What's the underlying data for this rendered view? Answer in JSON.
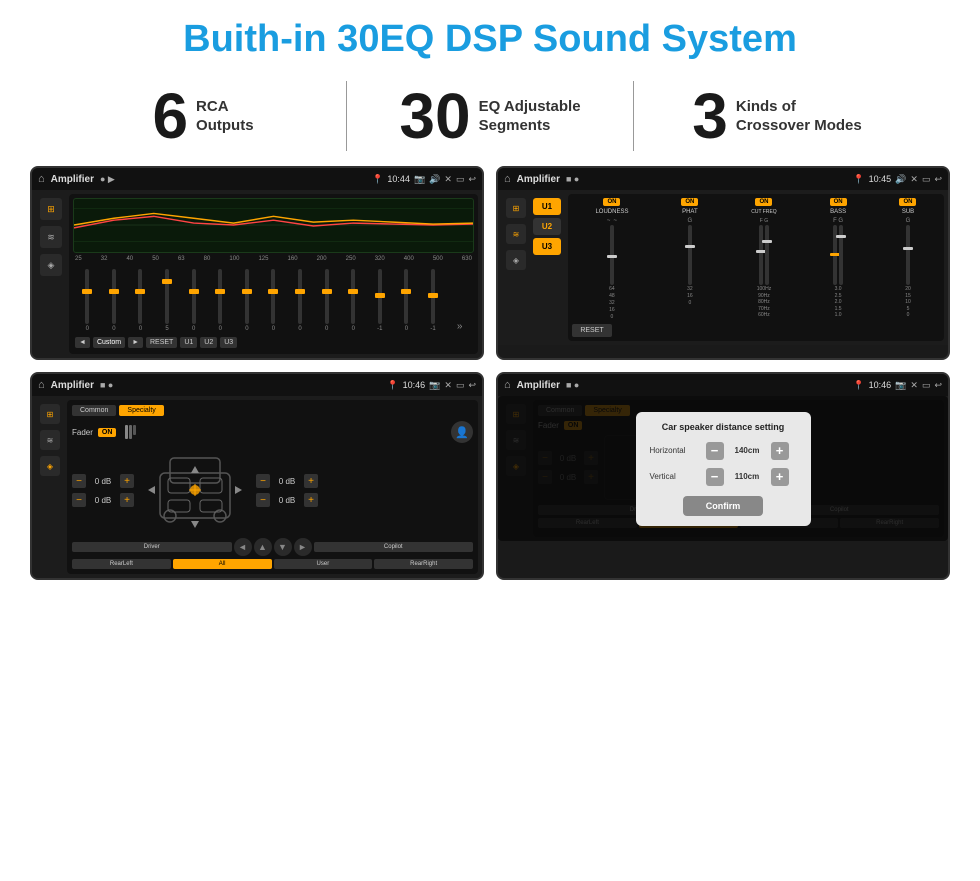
{
  "header": {
    "title": "Buith-in 30EQ DSP Sound System"
  },
  "stats": [
    {
      "number": "6",
      "label": "RCA\nOutputs"
    },
    {
      "number": "30",
      "label": "EQ Adjustable\nSegments"
    },
    {
      "number": "3",
      "label": "Kinds of\nCrossover Modes"
    }
  ],
  "screens": {
    "screen1": {
      "app_name": "Amplifier",
      "time": "10:44",
      "freq_labels": [
        "25",
        "32",
        "40",
        "50",
        "63",
        "80",
        "100",
        "125",
        "160",
        "200",
        "250",
        "320",
        "400",
        "500",
        "630"
      ],
      "slider_values": [
        "0",
        "0",
        "0",
        "5",
        "0",
        "0",
        "0",
        "0",
        "0",
        "0",
        "0",
        "-1",
        "0",
        "-1"
      ],
      "bottom_btns": [
        "◄",
        "Custom",
        "►",
        "RESET",
        "U1",
        "U2",
        "U3"
      ]
    },
    "screen2": {
      "app_name": "Amplifier",
      "time": "10:45",
      "u_buttons": [
        "U1",
        "U2",
        "U3"
      ],
      "channels": [
        "LOUDNESS",
        "PHAT",
        "CUT FREQ",
        "BASS",
        "SUB"
      ],
      "channel_states": [
        "ON",
        "ON",
        "ON",
        "ON",
        "ON"
      ],
      "reset_label": "RESET"
    },
    "screen3": {
      "app_name": "Amplifier",
      "time": "10:46",
      "tabs": [
        "Common",
        "Specialty"
      ],
      "active_tab": "Specialty",
      "fader_label": "Fader",
      "fader_on": "ON",
      "speaker_values": [
        "0 dB",
        "0 dB",
        "0 dB",
        "0 dB"
      ],
      "bottom_labels": [
        "Driver",
        "",
        "Copilot",
        "RearLeft",
        "All",
        "User",
        "RearRight"
      ],
      "arrows": [
        "◄",
        "▲",
        "▼",
        "►"
      ]
    },
    "screen4": {
      "app_name": "Amplifier",
      "time": "10:46",
      "tabs": [
        "Common",
        "Specialty"
      ],
      "dialog": {
        "title": "Car speaker distance setting",
        "horizontal_label": "Horizontal",
        "horizontal_value": "140cm",
        "vertical_label": "Vertical",
        "vertical_value": "110cm",
        "confirm_label": "Confirm"
      },
      "speaker_values": [
        "0 dB",
        "0 dB"
      ],
      "bottom_labels": [
        "Driver",
        "Copilot",
        "RearLeft",
        "User",
        "RearRight"
      ]
    }
  }
}
